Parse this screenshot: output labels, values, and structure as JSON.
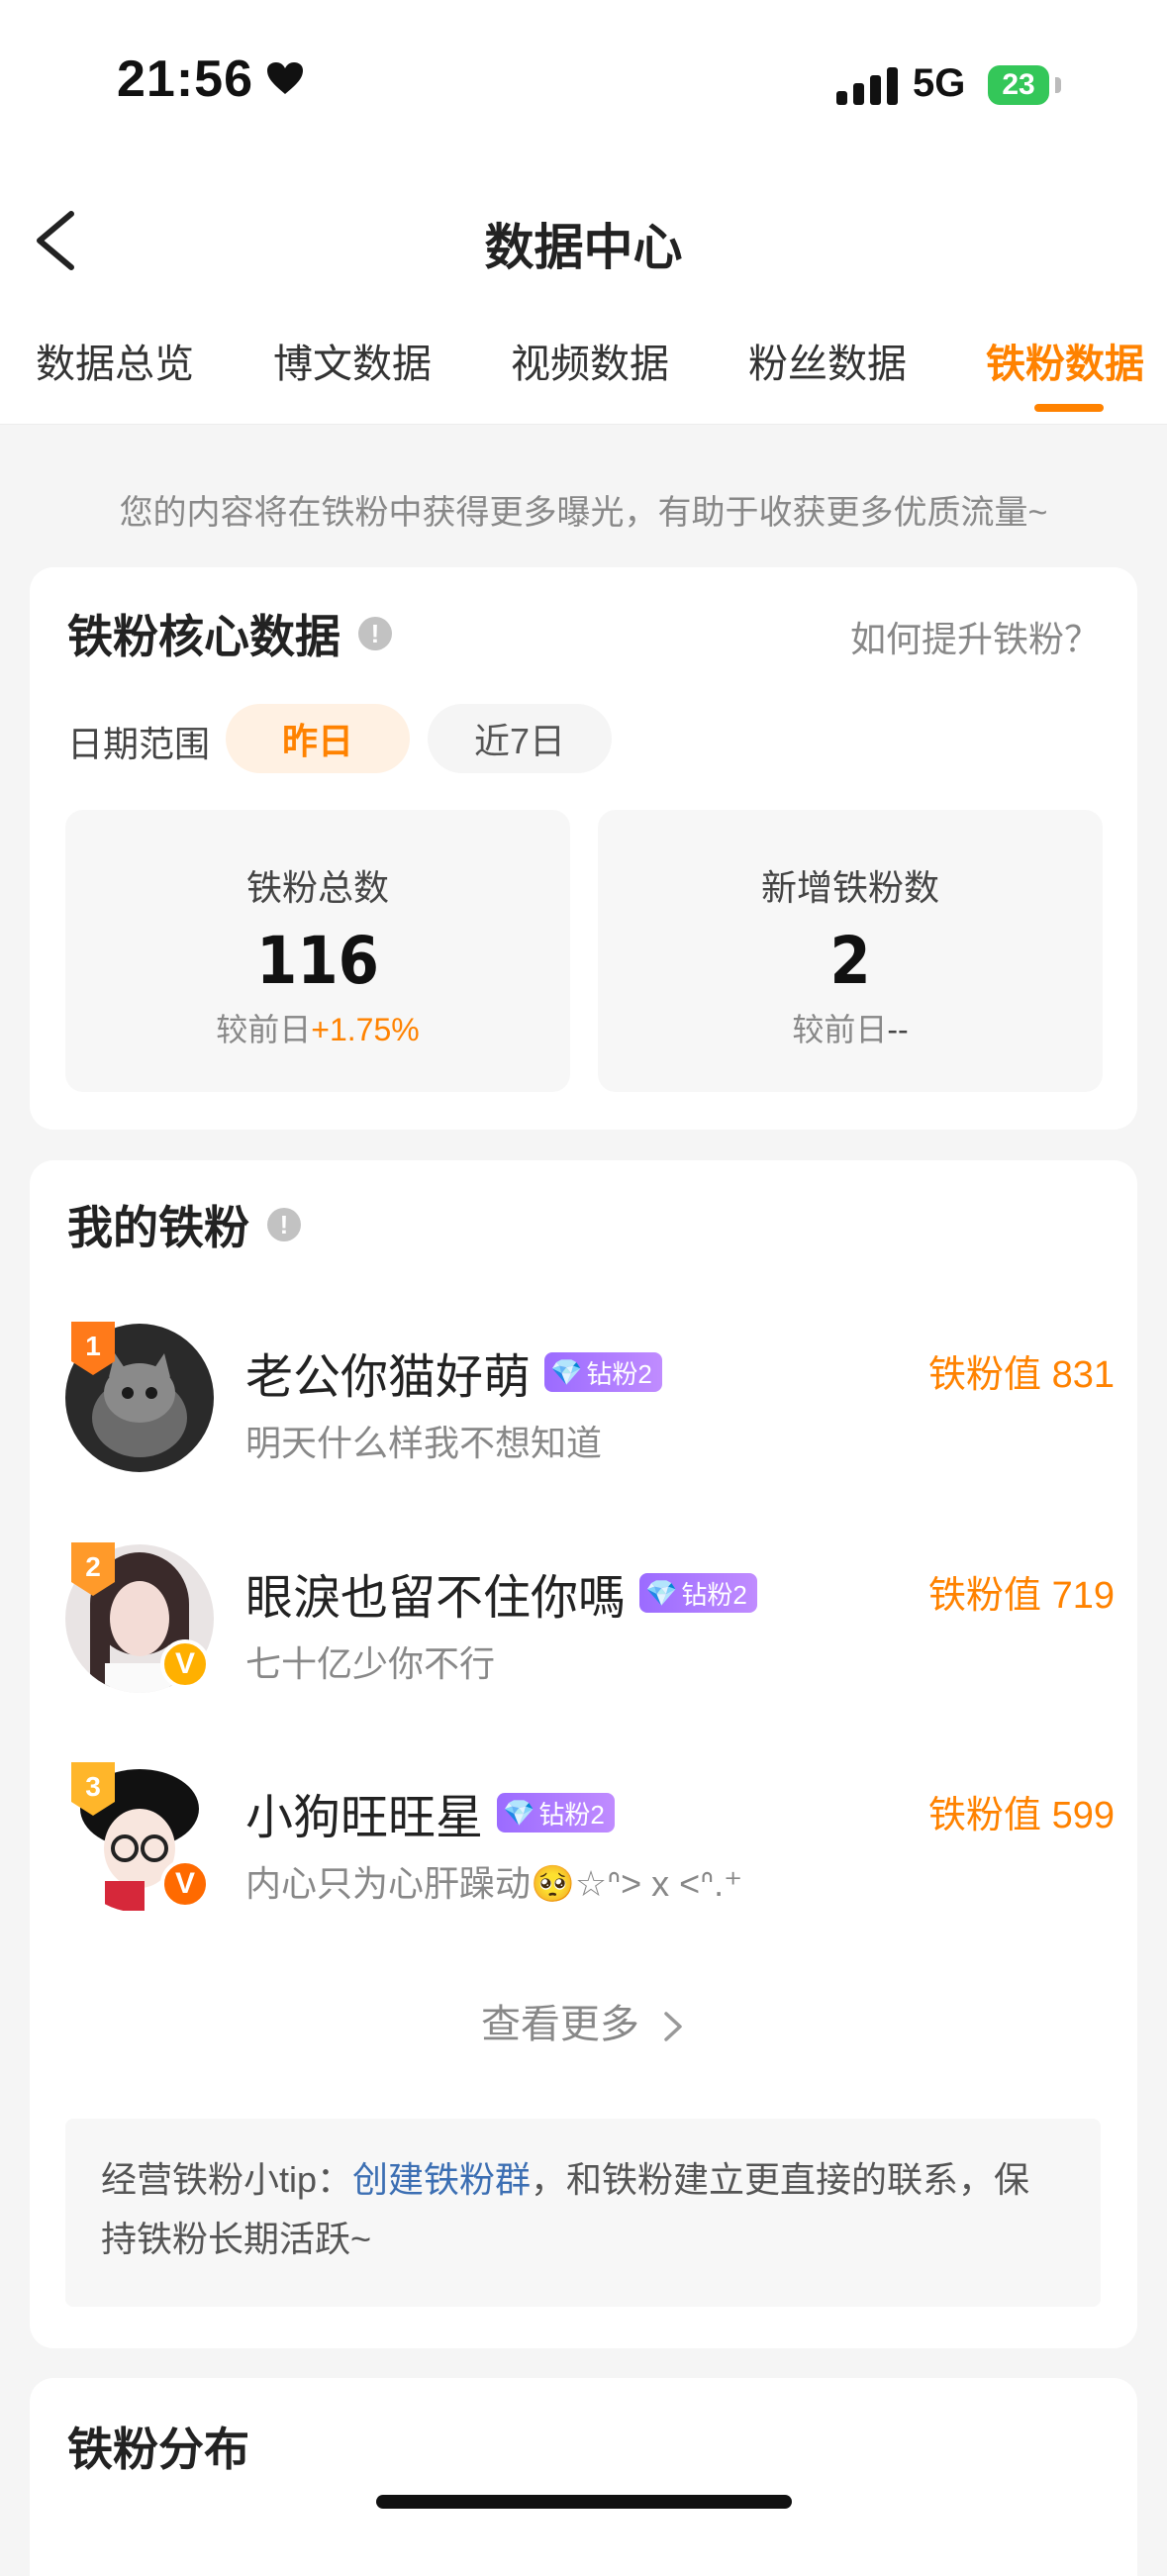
{
  "status": {
    "time": "21:56",
    "network": "5G",
    "battery": "23"
  },
  "header": {
    "title": "数据中心"
  },
  "tabs": [
    {
      "label": "数据总览",
      "active": false
    },
    {
      "label": "博文数据",
      "active": false
    },
    {
      "label": "视频数据",
      "active": false
    },
    {
      "label": "粉丝数据",
      "active": false
    },
    {
      "label": "铁粉数据",
      "active": true
    }
  ],
  "notice": "您的内容将在铁粉中获得更多曝光，有助于收获更多优质流量~",
  "core": {
    "title": "铁粉核心数据",
    "help_link": "如何提升铁粉？",
    "date_label": "日期范围",
    "date_options": [
      "昨日",
      "近7日"
    ],
    "stats": [
      {
        "label": "铁粉总数",
        "value": "116",
        "compare_prefix": "较前日",
        "compare_value": "+1.75%"
      },
      {
        "label": "新增铁粉数",
        "value": "2",
        "compare_prefix": "较前日",
        "compare_value": "--"
      }
    ]
  },
  "fans_section": {
    "title": "我的铁粉",
    "score_label": "铁粉值",
    "fans": [
      {
        "rank": "1",
        "name": "老公你猫好萌",
        "level": "钻粉2",
        "signature": "明天什么样我不想知道",
        "score": "831",
        "verified": ""
      },
      {
        "rank": "2",
        "name": "眼淚也留不住你嗎",
        "level": "钻粉2",
        "signature": "七十亿少你不行",
        "score": "719",
        "verified": "V"
      },
      {
        "rank": "3",
        "name": "小狗旺旺星",
        "level": "钻粉2",
        "signature": "内心只为心肝躁动🥺☆ᐢ> x <ᐢ.⁺",
        "score": "599",
        "verified": "V"
      }
    ],
    "see_more": "查看更多",
    "tip_prefix": "经营铁粉小tip：",
    "tip_link": "创建铁粉群",
    "tip_suffix": "，和铁粉建立更直接的联系，保持铁粉长期活跃~"
  },
  "distribution": {
    "title": "铁粉分布"
  },
  "colors": {
    "accent": "#ff8200",
    "link": "#3c6fb3",
    "gold_badge": "#ffb000",
    "orange_badge": "#ff6a00"
  }
}
